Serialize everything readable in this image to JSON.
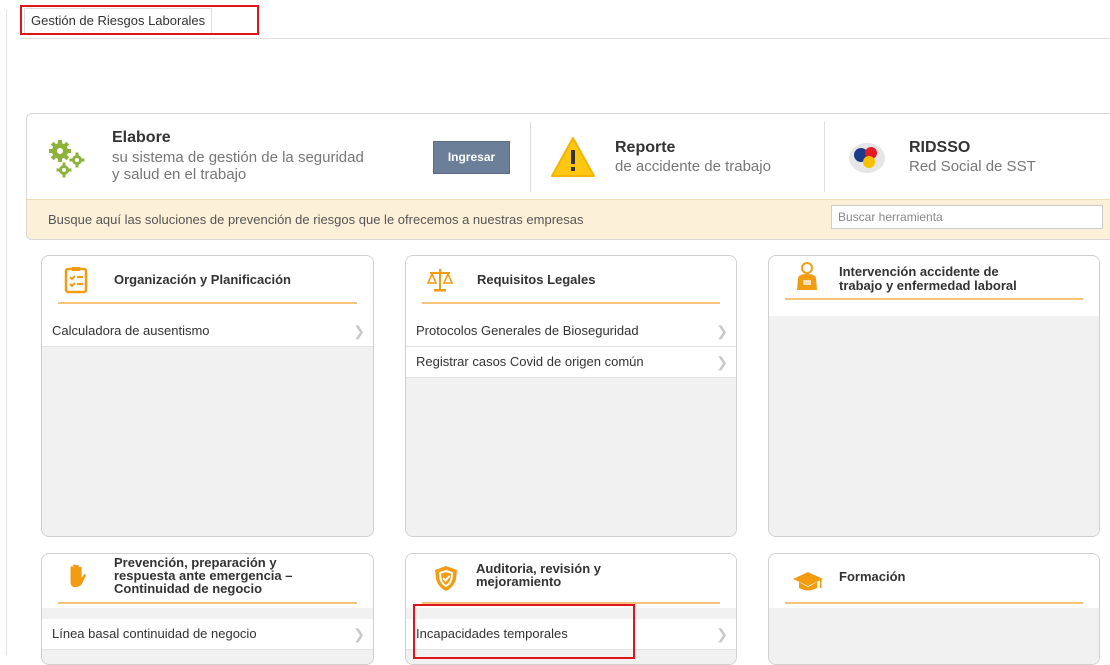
{
  "tab": {
    "label": "Gestión de Riesgos Laborales"
  },
  "banner": {
    "elabore": {
      "title": "Elabore",
      "line1": "su sistema de gestión de la seguridad",
      "line2": "y salud en el trabajo",
      "button": "Ingresar"
    },
    "reporte": {
      "title": "Reporte",
      "subtitle": "de accidente de trabajo"
    },
    "ridsso": {
      "title": "RIDSSO",
      "subtitle": "Red Social de SST"
    }
  },
  "search": {
    "text": "Busque aquí las soluciones de prevención de riesgos que le ofrecemos a nuestras empresas",
    "placeholder": "Buscar herramienta"
  },
  "cards": {
    "organizacion": {
      "title": "Organización y Planificación",
      "items": [
        "Calculadora de ausentismo"
      ]
    },
    "requisitos": {
      "title": "Requisitos Legales",
      "items": [
        "Protocolos Generales de Bioseguridad",
        "Registrar casos Covid de origen común"
      ]
    },
    "intervencion": {
      "title_line1": "Intervención accidente de",
      "title_line2": "trabajo y enfermedad laboral"
    },
    "prevencion": {
      "title_line1": "Prevención, preparación y",
      "title_line2": "respuesta ante emergencia –",
      "title_line3": "Continuidad de negocio",
      "items": [
        "Línea basal continuidad de negocio"
      ]
    },
    "auditoria": {
      "title_line1": "Auditoria, revisión y",
      "title_line2": "mejoramiento",
      "items": [
        "Incapacidades temporales"
      ]
    },
    "formacion": {
      "title": "Formación"
    }
  },
  "colors": {
    "accent": "#f7c27a",
    "icon_orange": "#f39c12",
    "button": "#6b7f99",
    "highlight": "#e0151b"
  }
}
